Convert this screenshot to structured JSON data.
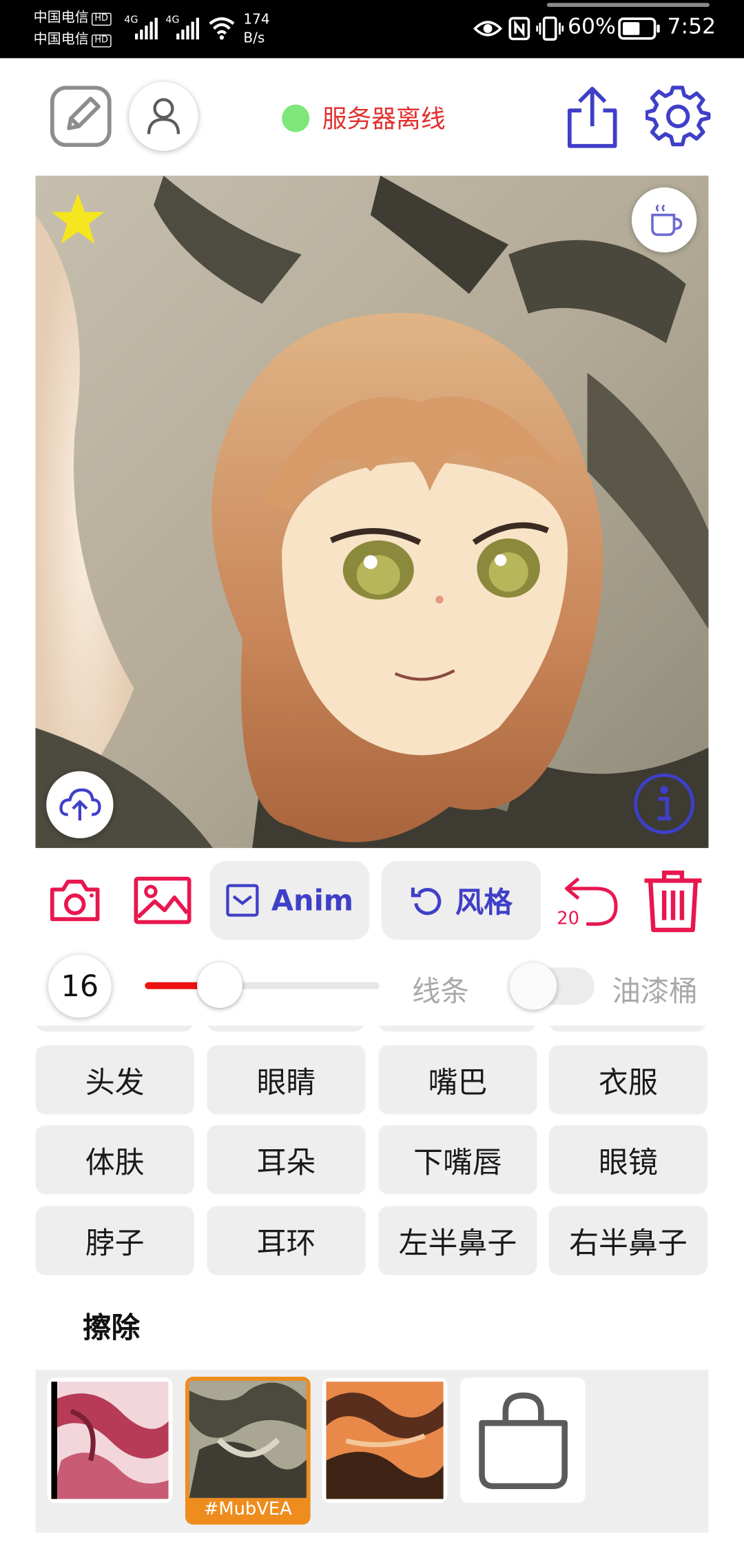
{
  "status_bar": {
    "carrier_1": "中国电信",
    "carrier_2": "中国电信",
    "hd_badge": "HD",
    "network_1": "4G",
    "network_2": "4G",
    "speed_value": "174",
    "speed_unit": "B/s",
    "battery": "60%",
    "time": "7:52"
  },
  "top_bar": {
    "server_status": "服务器离线",
    "server_status_color": "#7ee77a"
  },
  "hero": {
    "favorite_color": "#f5e61f"
  },
  "toolbar": {
    "anim_label": "Anim",
    "style_label": "风格",
    "undo_count": "20"
  },
  "brush": {
    "size": "16",
    "slider_fraction": 0.32,
    "lines_label": "线条",
    "bucket_label": "油漆桶"
  },
  "parts": [
    [
      "头发",
      "眼睛",
      "嘴巴",
      "衣服"
    ],
    [
      "体肤",
      "耳朵",
      "下嘴唇",
      "眼镜"
    ],
    [
      "脖子",
      "耳环",
      "左半鼻子",
      "右半鼻子"
    ]
  ],
  "erase_label": "擦除",
  "thumbnails": {
    "selected_tag": "#MubVEA",
    "selected_color": "#ee8c1e"
  },
  "colors": {
    "accent": "#e8174f",
    "action_blue": "#3f3fc8",
    "slider_fill": "#ee1111"
  }
}
